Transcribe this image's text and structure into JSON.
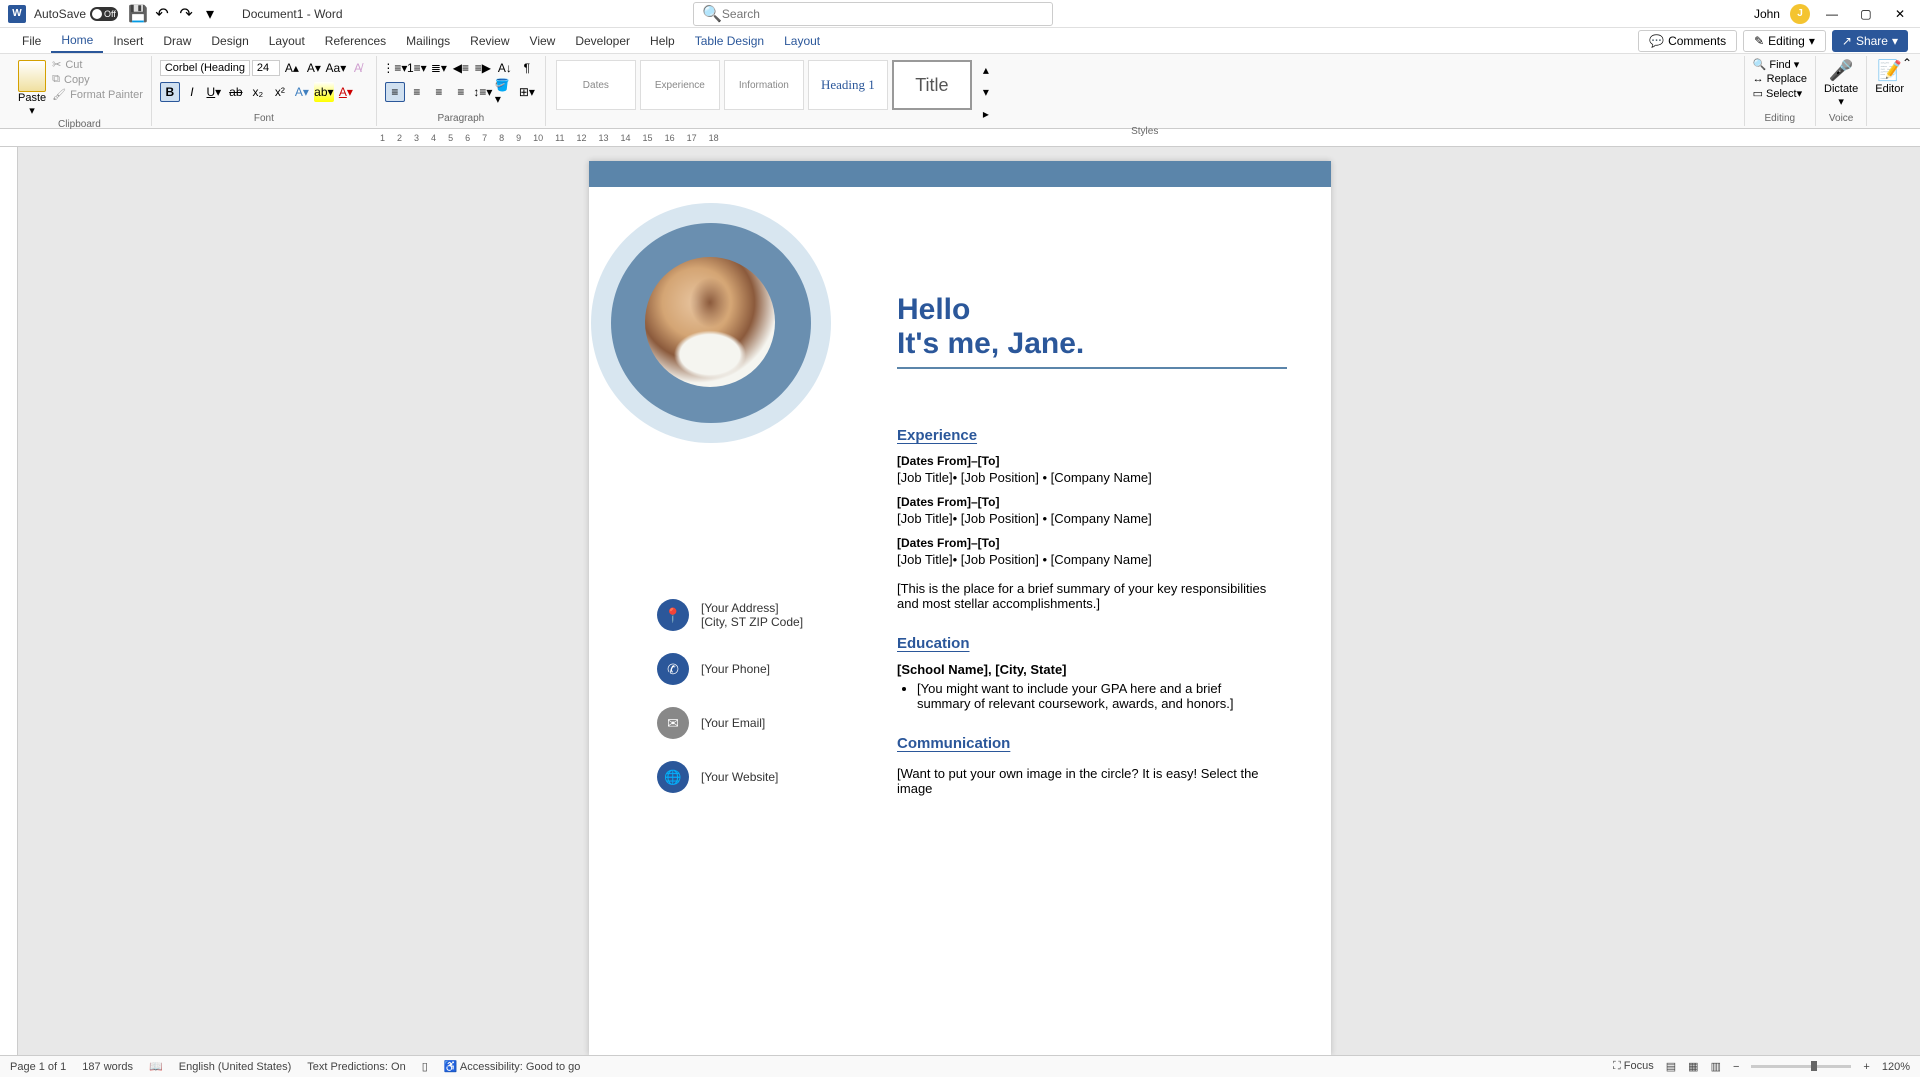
{
  "titlebar": {
    "autosave": "AutoSave",
    "autosave_state": "Off",
    "document": "Document1  -  Word",
    "search_placeholder": "Search",
    "user": "John",
    "user_initial": "J"
  },
  "menu": {
    "tabs": [
      "File",
      "Home",
      "Insert",
      "Draw",
      "Design",
      "Layout",
      "References",
      "Mailings",
      "Review",
      "View",
      "Developer",
      "Help",
      "Table Design",
      "Layout"
    ],
    "active": "Home",
    "comments": "Comments",
    "editing": "Editing",
    "share": "Share"
  },
  "ribbon": {
    "clipboard": {
      "label": "Clipboard",
      "paste": "Paste",
      "cut": "Cut",
      "copy": "Copy",
      "format_painter": "Format Painter"
    },
    "font": {
      "label": "Font",
      "name": "Corbel (Headings)",
      "size": "24"
    },
    "paragraph": {
      "label": "Paragraph"
    },
    "styles": {
      "label": "Styles",
      "items": [
        "Dates",
        "Experience",
        "Information",
        "Heading 1",
        "Title"
      ]
    },
    "editing": {
      "label": "Editing",
      "find": "Find",
      "replace": "Replace",
      "select": "Select"
    },
    "voice": {
      "label": "Voice",
      "dictate": "Dictate"
    },
    "editor": {
      "label": "Editor"
    }
  },
  "document": {
    "hello1": "Hello",
    "hello2": "It's me, Jane.",
    "experience_h": "Experience",
    "exp": [
      {
        "dates": "[Dates From]–[To]",
        "line": "[Job Title]• [Job Position] • [Company Name]"
      },
      {
        "dates": "[Dates From]–[To]",
        "line": "[Job Title]• [Job Position] • [Company Name]"
      },
      {
        "dates": "[Dates From]–[To]",
        "line": "[Job Title]• [Job Position] • [Company Name]"
      }
    ],
    "summary": "[This is the place for a brief summary of your key responsibilities and most stellar accomplishments.]",
    "education_h": "Education",
    "school": "[School Name], [City, State]",
    "edu_bullet": "[You might want to include your GPA here and a brief summary of relevant coursework, awards, and honors.]",
    "communication_h": "Communication",
    "comm_text": "[Want to put your own image in the circle?  It is easy!  Select the image",
    "contact": {
      "address1": "[Your Address]",
      "address2": "[City, ST ZIP Code]",
      "phone": "[Your Phone]",
      "email": "[Your Email]",
      "website": "[Your Website]"
    }
  },
  "statusbar": {
    "page": "Page 1 of 1",
    "words": "187 words",
    "lang": "English (United States)",
    "predictions": "Text Predictions: On",
    "accessibility": "Accessibility: Good to go",
    "focus": "Focus",
    "zoom": "120%"
  }
}
